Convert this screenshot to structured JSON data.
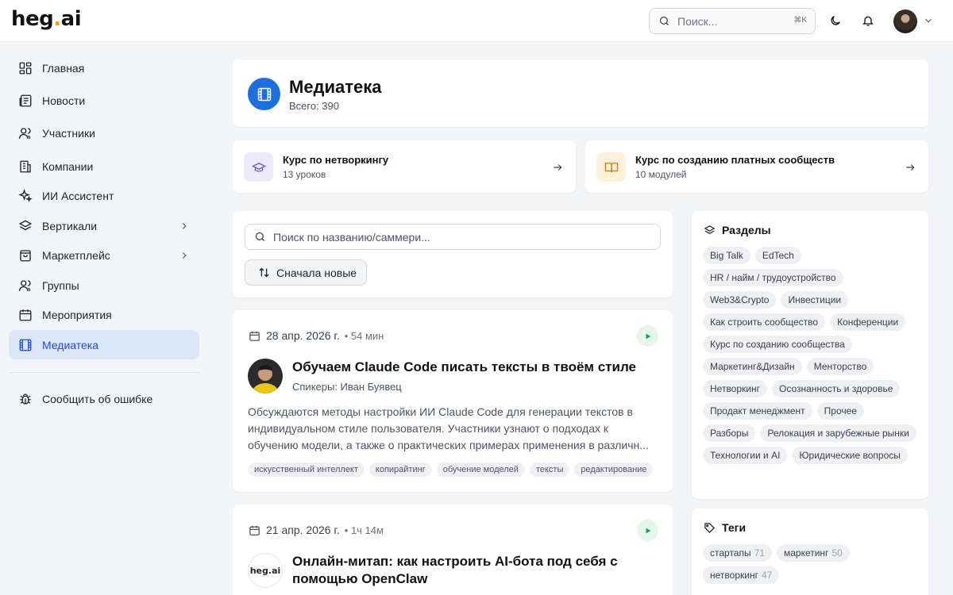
{
  "brand": {
    "logo_main": "heg",
    "logo_dot": ".",
    "logo_tail": "ai"
  },
  "header": {
    "search_placeholder": "Поиск...",
    "search_shortcut": "⌘K"
  },
  "sidebar": {
    "items": [
      {
        "label": "Главная",
        "icon": "grid-icon"
      },
      {
        "label": "Новости",
        "icon": "newspaper-icon"
      },
      {
        "label": "Участники",
        "icon": "users-icon"
      },
      {
        "label": "Компании",
        "icon": "building-icon"
      },
      {
        "label": "ИИ Ассистент",
        "icon": "sparkles-icon"
      },
      {
        "label": "Вертикали",
        "icon": "layers-icon"
      },
      {
        "label": "Маркетплейс",
        "icon": "shopping-bag-icon"
      },
      {
        "label": "Группы",
        "icon": "group-icon"
      },
      {
        "label": "Мероприятия",
        "icon": "calendar-icon"
      },
      {
        "label": "Медиатека",
        "icon": "film-icon",
        "active": true
      }
    ],
    "report_label": "Сообщить об ошибке"
  },
  "media": {
    "title": "Медиатека",
    "total": "Всего: 390"
  },
  "courses": [
    {
      "title": "Курс по нетворкингу",
      "sub": "13 уроков"
    },
    {
      "title": "Курс по созданию платных сообществ",
      "sub": "10 модулей"
    }
  ],
  "filter": {
    "search_placeholder": "Поиск по названию/саммери...",
    "sort_label": "Сначала новые"
  },
  "posts": [
    {
      "date": "28 апр. 2026 г.",
      "duration": "• 54 мин",
      "title": "Обучаем Claude Code писать тексты в твоём стиле",
      "speakers": "Спикеры: Иван Буявец",
      "description": "Обсуждаются методы настройки ИИ Claude Code для генерации текстов в индивидуальном стиле пользователя. Участники узнают о подходах к обучению модели, а также о практических примерах применения в различн...",
      "tags": [
        "искусственный интеллект",
        "копирайтинг",
        "обучение моделей",
        "тексты",
        "редактирование"
      ]
    },
    {
      "date": "21 апр. 2026 г.",
      "duration": "• 1ч 14м",
      "title": "Онлайн-митап: как настроить AI-бота под себя с помощью OpenClaw",
      "avatar_text": "heg.ai"
    }
  ],
  "sections": {
    "title": "Разделы",
    "items": [
      "Big Talk",
      "EdTech",
      "HR / найм / трудоустройство",
      "Web3&Crypto",
      "Инвестиции",
      "Как строить сообщество",
      "Конференции",
      "Курс по созданию сообщества",
      "Маркетинг&Дизайн",
      "Менторство",
      "Нетворкинг",
      "Осознанность и здоровье",
      "Продакт менеджмент",
      "Прочее",
      "Разборы",
      "Релокация и зарубежные рынки",
      "Технологии и AI",
      "Юридические вопросы"
    ]
  },
  "tags": {
    "title": "Теги",
    "items": [
      {
        "name": "стартапы",
        "count": "71"
      },
      {
        "name": "маркетинг",
        "count": "50"
      },
      {
        "name": "нетворкинг",
        "count": "47"
      }
    ]
  },
  "colors": {
    "accent": "#1d6fe0",
    "active_bg": "#dbe6f7",
    "play": "#16a34a",
    "logo_dot": "#f59e0b"
  }
}
